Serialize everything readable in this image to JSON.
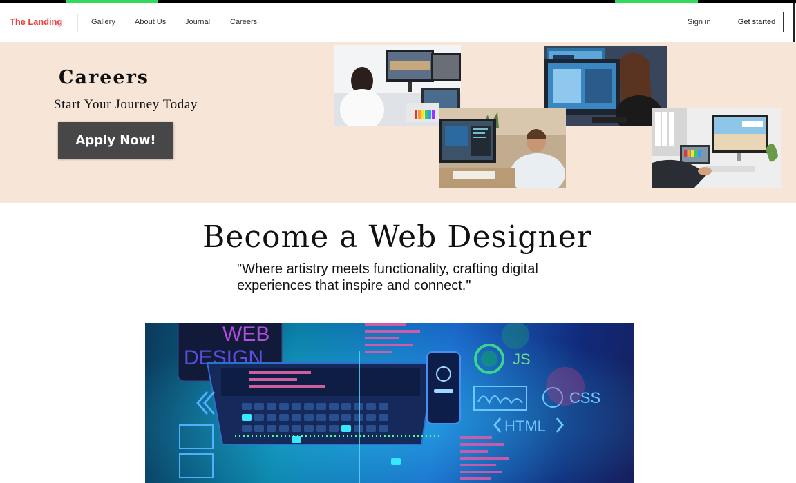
{
  "brand": {
    "logo": "The Landing",
    "accent": "#e8413f"
  },
  "nav": {
    "links": [
      "Gallery",
      "About Us",
      "Journal",
      "Careers"
    ],
    "sign_in": "Sign in",
    "get_started": "Get started"
  },
  "hero": {
    "title": "Careers",
    "subtitle": "Start Your Journey Today",
    "cta": "Apply Now!",
    "background": "#f7e5d8",
    "button_color": "#474747"
  },
  "main": {
    "title": "Become a Web Designer",
    "quote": "\"Where artistry meets functionality, crafting digital experiences that inspire and connect.\""
  },
  "banner": {
    "heading": "WEB DESIGN",
    "tags": [
      "JS",
      "CSS",
      "HTML"
    ]
  }
}
